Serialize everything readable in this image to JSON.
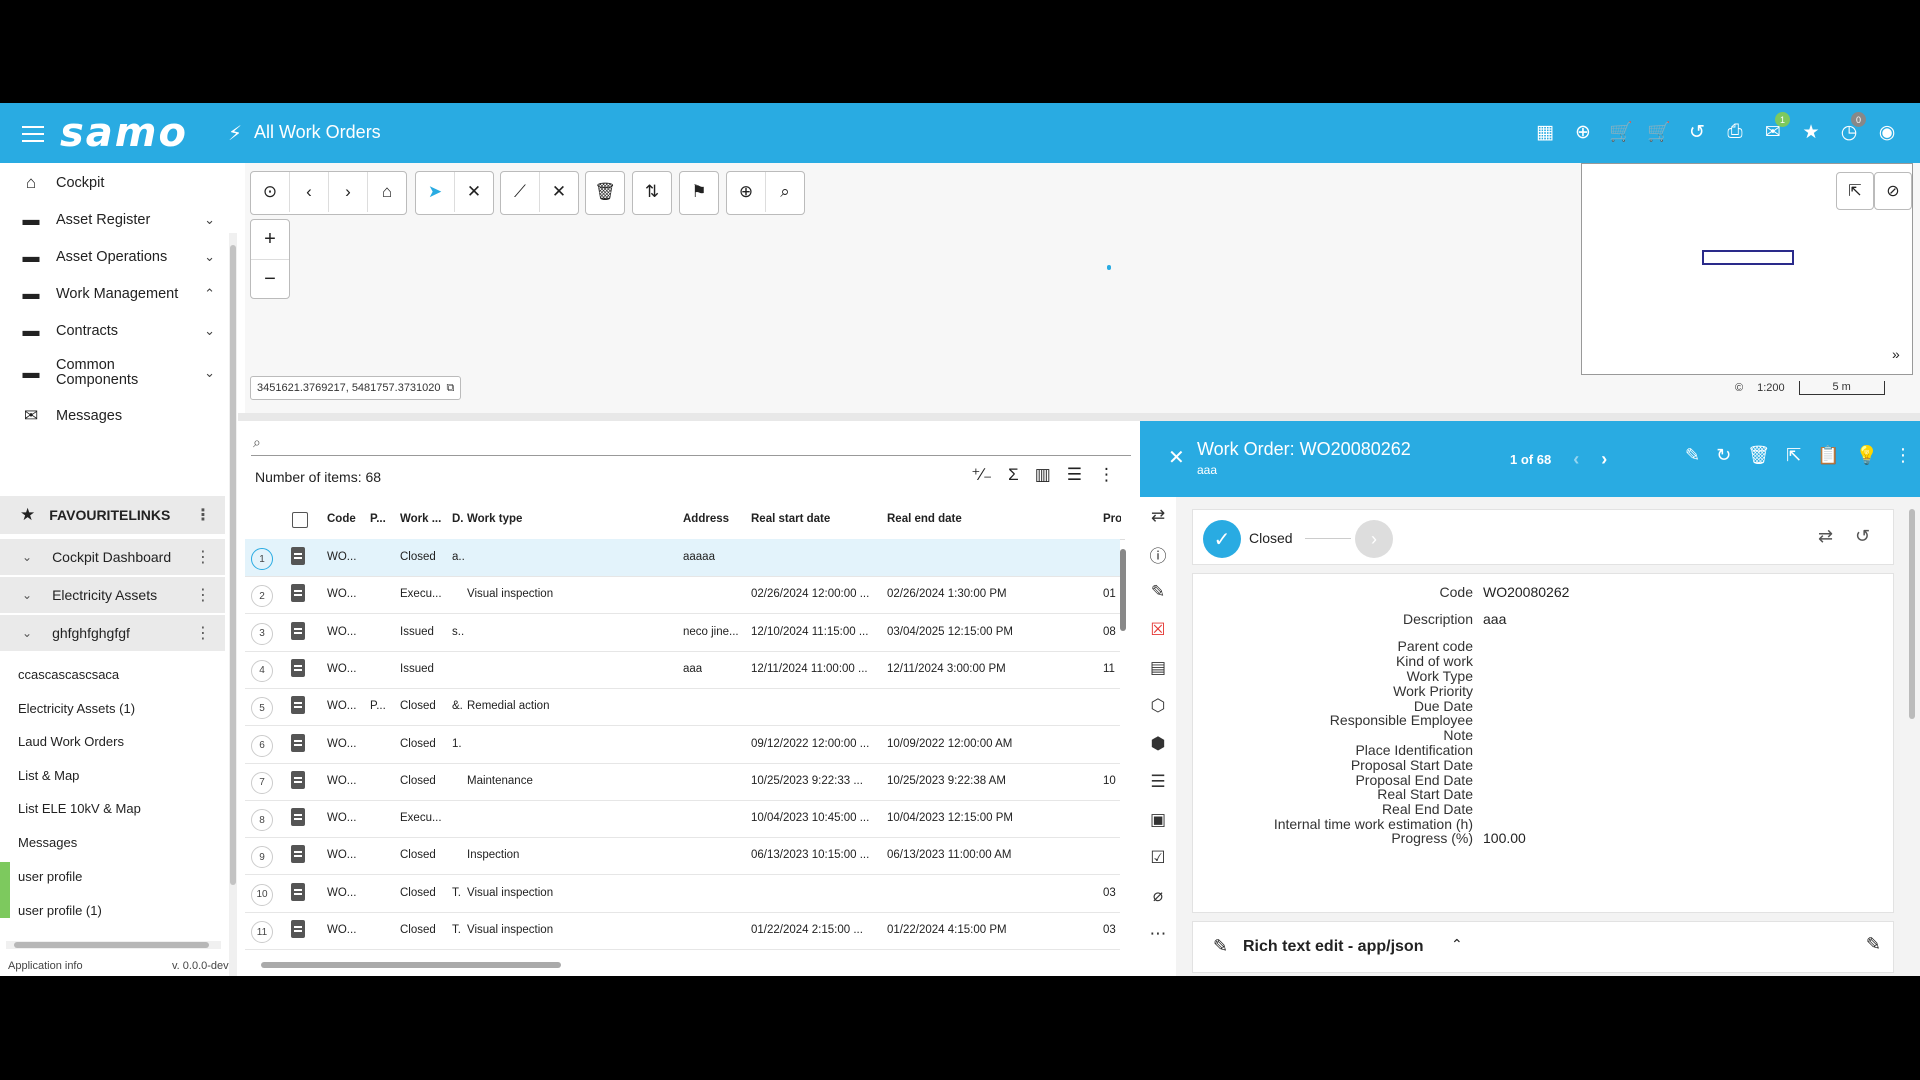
{
  "header": {
    "logo": "samo",
    "title": "All Work Orders",
    "icons": [
      "dashboard-icon",
      "add-circle-icon",
      "cart-add-icon",
      "cart-icon",
      "history-icon",
      "print-icon",
      "mail-icon",
      "star-icon",
      "timer-icon",
      "account-icon"
    ],
    "mail_badge": "1",
    "timer_badge": "0",
    "mail_badge_color": "#7dc95e",
    "timer_badge_color": "#888888"
  },
  "sidebar": {
    "nav": [
      {
        "label": "Cockpit",
        "icon": "home-icon"
      },
      {
        "label": "Asset Register",
        "icon": "folder-icon"
      },
      {
        "label": "Asset Operations",
        "icon": "folder-icon"
      },
      {
        "label": "Work Management",
        "icon": "folder-icon"
      },
      {
        "label": "Contracts",
        "icon": "folder-icon"
      },
      {
        "label": "Common Components",
        "icon": "folder-icon"
      },
      {
        "label": "Messages",
        "icon": "mail-icon"
      }
    ],
    "favourites_label": "FAVOURITELINKS",
    "fav_groups": [
      "Cockpit Dashboard",
      "Electricity Assets",
      "ghfghfghgfgf"
    ],
    "fav_links": [
      "ccascascascsaca",
      "Electricity Assets (1)",
      "Laud Work Orders",
      "List & Map",
      "List ELE 10kV & Map",
      "Messages",
      "user profile",
      "user profile (1)"
    ],
    "app_info": "Application info",
    "version": "v. 0.0.0-dev"
  },
  "map": {
    "coords": "3451621.3769217, 5481757.3731020",
    "scale_ratio": "1:200",
    "scale_bar": "5 m",
    "attribution": "©"
  },
  "list": {
    "count": "Number of items: 68",
    "columns": [
      "Code",
      "P...",
      "Work ...",
      "D.",
      "Work type",
      "Address",
      "Real start date",
      "Real end date",
      "Propo"
    ],
    "rows": [
      {
        "n": "1",
        "code": "WO...",
        "p": "",
        "status": "Closed",
        "d": "a..",
        "type": "",
        "addr": "aaaaa",
        "start": "",
        "end": "",
        "prop": ""
      },
      {
        "n": "2",
        "code": "WO...",
        "p": "",
        "status": "Execu...",
        "d": "",
        "type": "Visual inspection",
        "addr": "",
        "start": "02/26/2024 12:00:00 ...",
        "end": "02/26/2024 1:30:00 PM",
        "prop": "01"
      },
      {
        "n": "3",
        "code": "WO...",
        "p": "",
        "status": "Issued",
        "d": "s..",
        "type": "",
        "addr": "neco jine...",
        "start": "12/10/2024 11:15:00 ...",
        "end": "03/04/2025 12:15:00 PM",
        "prop": "08"
      },
      {
        "n": "4",
        "code": "WO...",
        "p": "",
        "status": "Issued",
        "d": "",
        "type": "",
        "addr": "aaa",
        "start": "12/11/2024 11:00:00 ...",
        "end": "12/11/2024 3:00:00 PM",
        "prop": "11"
      },
      {
        "n": "5",
        "code": "WO...",
        "p": "P...",
        "status": "Closed",
        "d": "&.",
        "type": "Remedial action",
        "addr": "",
        "start": "",
        "end": "",
        "prop": ""
      },
      {
        "n": "6",
        "code": "WO...",
        "p": "",
        "status": "Closed",
        "d": "1.",
        "type": "",
        "addr": "",
        "start": "09/12/2022 12:00:00 ...",
        "end": "10/09/2022 12:00:00 AM",
        "prop": ""
      },
      {
        "n": "7",
        "code": "WO...",
        "p": "",
        "status": "Closed",
        "d": "",
        "type": "Maintenance",
        "addr": "",
        "start": "10/25/2023 9:22:33 ...",
        "end": "10/25/2023 9:22:38 AM",
        "prop": "10"
      },
      {
        "n": "8",
        "code": "WO...",
        "p": "",
        "status": "Execu...",
        "d": "",
        "type": "",
        "addr": "",
        "start": "10/04/2023 10:45:00 ...",
        "end": "10/04/2023 12:15:00 PM",
        "prop": ""
      },
      {
        "n": "9",
        "code": "WO...",
        "p": "",
        "status": "Closed",
        "d": "",
        "type": "Inspection",
        "addr": "",
        "start": "06/13/2023 10:15:00 ...",
        "end": "06/13/2023 11:00:00 AM",
        "prop": ""
      },
      {
        "n": "10",
        "code": "WO...",
        "p": "",
        "status": "Closed",
        "d": "T.",
        "type": "Visual inspection",
        "addr": "",
        "start": "",
        "end": "",
        "prop": "03"
      },
      {
        "n": "11",
        "code": "WO...",
        "p": "",
        "status": "Closed",
        "d": "T.",
        "type": "Visual inspection",
        "addr": "",
        "start": "01/22/2024 2:15:00 ...",
        "end": "01/22/2024 4:15:00 PM",
        "prop": "03"
      }
    ]
  },
  "detail": {
    "title": "Work Order: WO20080262",
    "subtitle": "aaa",
    "pager": "1 of 68",
    "status": "Closed",
    "fields": [
      {
        "label": "Code",
        "value": "WO20080262"
      },
      {
        "label": "Description",
        "value": "aaa"
      },
      {
        "label": "Parent code",
        "value": ""
      },
      {
        "label": "Kind of work",
        "value": ""
      },
      {
        "label": "Work Type",
        "value": ""
      },
      {
        "label": "Work Priority",
        "value": ""
      },
      {
        "label": "Due Date",
        "value": ""
      },
      {
        "label": "Responsible Employee",
        "value": ""
      },
      {
        "label": "Note",
        "value": ""
      },
      {
        "label": "Place Identification",
        "value": ""
      },
      {
        "label": "Proposal Start Date",
        "value": ""
      },
      {
        "label": "Proposal End Date",
        "value": ""
      },
      {
        "label": "Real Start Date",
        "value": ""
      },
      {
        "label": "Real End Date",
        "value": ""
      },
      {
        "label": "Internal time work estimation (h)",
        "value": ""
      },
      {
        "label": "Progress (%)",
        "value": "100.00"
      }
    ],
    "rich_text_title": "Rich text edit - app/json"
  },
  "colors": {
    "accent": "#29abe2",
    "selected_row": "#e3f3fb",
    "danger": "#e53935"
  }
}
